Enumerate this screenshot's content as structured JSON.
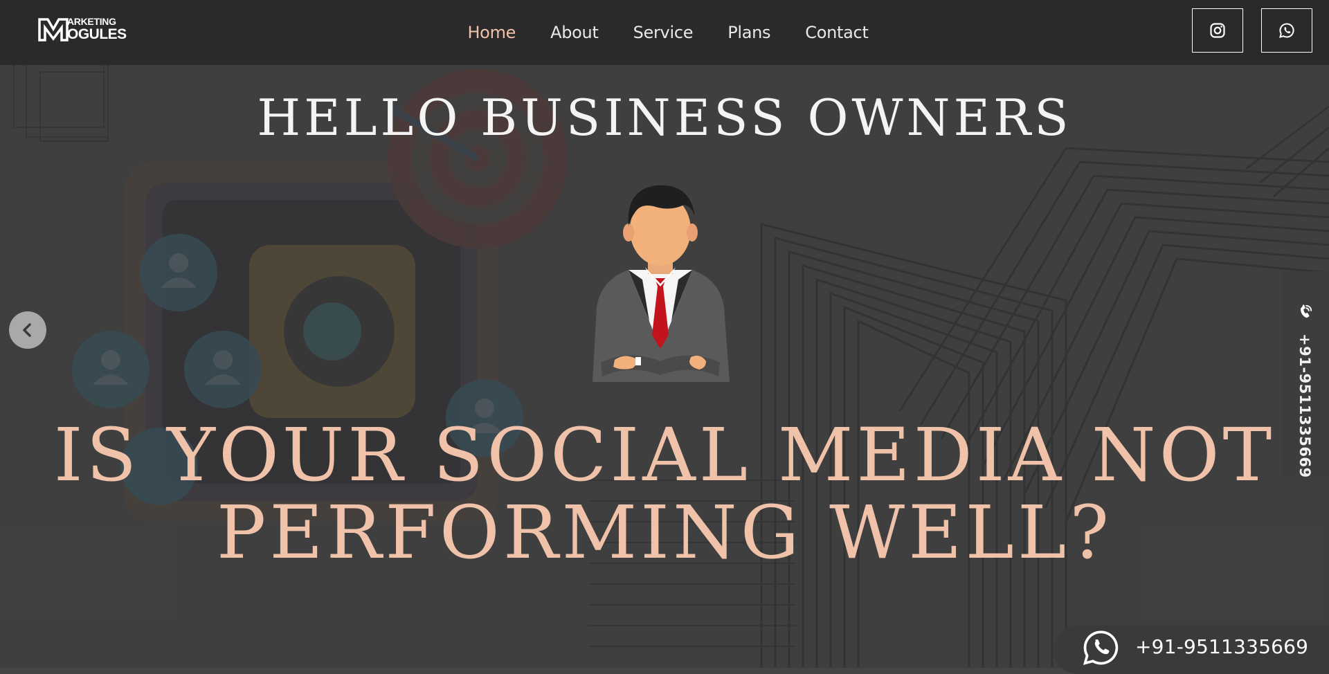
{
  "brand": {
    "logo_letter": "M",
    "logo_top": "ARKETING",
    "logo_bottom": "OGULES"
  },
  "nav": {
    "items": [
      "Home",
      "About",
      "Service",
      "Plans",
      "Contact"
    ],
    "active": "Home"
  },
  "social": {
    "instagram_icon": "instagram-icon",
    "whatsapp_icon": "whatsapp-icon"
  },
  "hero": {
    "heading": "HELLO BUSINESS OWNERS",
    "sub_line1": "IS YOUR SOCIAL MEDIA NOT",
    "sub_line2": "PERFORMING WELL?"
  },
  "side_call": {
    "phone": "+91-9511335669",
    "icon": "phone-icon"
  },
  "whatsapp_pill": {
    "phone": "+91-9511335669",
    "icon": "whatsapp-icon"
  },
  "colors": {
    "header_bg": "#2b2a2a",
    "accent": "#f0c2aa",
    "hero_bg": "#474747"
  }
}
